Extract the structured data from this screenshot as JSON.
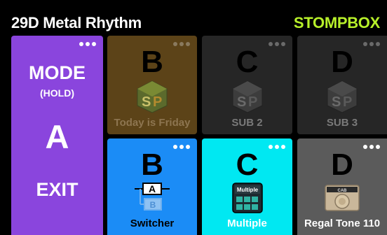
{
  "header": {
    "preset_name": "29D Metal Rhythm",
    "mode": "STOMPBOX",
    "mode_color": "#b7f02a"
  },
  "mode_tile": {
    "line1": "MODE",
    "line2": "(HOLD)",
    "bank": "A",
    "action": "EXIT",
    "color": "#8a45dd"
  },
  "tiles": [
    {
      "letter": "B",
      "label": "Today is Friday",
      "icon": "sp-logo-icon",
      "state": "inactive",
      "color": "#5c4318"
    },
    {
      "letter": "C",
      "label": "SUB 2",
      "icon": "sp-logo-icon",
      "state": "inactive",
      "color": "#262626"
    },
    {
      "letter": "D",
      "label": "SUB 3",
      "icon": "sp-logo-icon",
      "state": "inactive",
      "color": "#262626"
    },
    {
      "letter": "B",
      "label": "Switcher",
      "icon": "ab-switcher-icon",
      "state": "active",
      "color": "#1b8cf6"
    },
    {
      "letter": "C",
      "label": "Multiple",
      "icon": "multiple-pedal-icon",
      "state": "active",
      "color": "#00e8f2"
    },
    {
      "letter": "D",
      "label": "Regal Tone 110",
      "icon": "amp-cab-icon",
      "state": "active",
      "color": "#5b5b5b"
    }
  ],
  "icons": {
    "multiple_text": "Multiple",
    "switcher_a": "A",
    "switcher_b": "B",
    "cab_text": "CAB"
  }
}
